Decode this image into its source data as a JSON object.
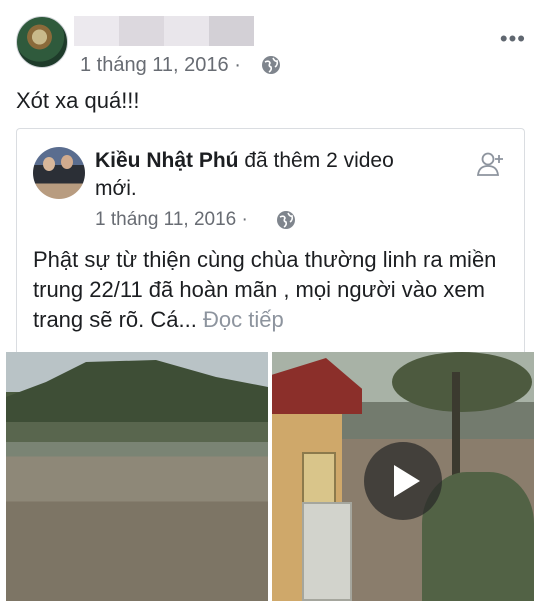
{
  "post": {
    "date": "1 tháng 11, 2016",
    "dot": "·",
    "more": "•••",
    "text": "Xót xa quá!!!"
  },
  "shared": {
    "author": "Kiều Nhật Phú",
    "action": " đã thêm 2 video mới.",
    "date": "1 tháng 11, 2016",
    "dot": "·",
    "body": "Phật sự  từ thiện cùng chùa thường linh ra miền trung 22/11 đã hoàn mãn , mọi người vào xem trang sẽ rõ. Cá...",
    "read_more": " Đọc tiếp"
  },
  "icons": {
    "privacy": "globe-icon",
    "add_friend": "add-friend-icon",
    "more": "more-options-icon",
    "play": "play-icon"
  }
}
